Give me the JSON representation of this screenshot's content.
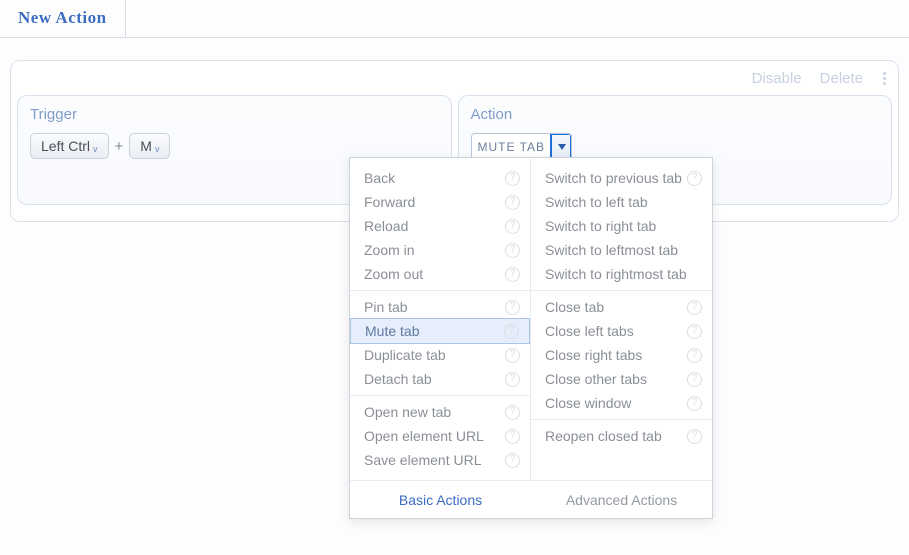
{
  "header": {
    "tab_title": "New Action",
    "disable_label": "Disable",
    "delete_label": "Delete"
  },
  "trigger": {
    "title": "Trigger",
    "keys": [
      "Left Ctrl",
      "M"
    ],
    "joiner": "+"
  },
  "action": {
    "title": "Action",
    "selected_label": "MUTE TAB"
  },
  "popup": {
    "left_groups": [
      {
        "items": [
          {
            "label": "Back",
            "help": true
          },
          {
            "label": "Forward",
            "help": true
          },
          {
            "label": "Reload",
            "help": true
          },
          {
            "label": "Zoom in",
            "help": true
          },
          {
            "label": "Zoom out",
            "help": true
          }
        ]
      },
      {
        "items": [
          {
            "label": "Pin tab",
            "help": true
          },
          {
            "label": "Mute tab",
            "help": true,
            "selected": true
          },
          {
            "label": "Duplicate tab",
            "help": true
          },
          {
            "label": "Detach tab",
            "help": true
          }
        ]
      },
      {
        "items": [
          {
            "label": "Open new tab",
            "help": true
          },
          {
            "label": "Open element URL",
            "help": true
          },
          {
            "label": "Save element URL",
            "help": true
          }
        ]
      }
    ],
    "right_groups": [
      {
        "items": [
          {
            "label": "Switch to previous tab",
            "help": true
          },
          {
            "label": "Switch to left tab",
            "help": false
          },
          {
            "label": "Switch to right tab",
            "help": false
          },
          {
            "label": "Switch to leftmost tab",
            "help": false
          },
          {
            "label": "Switch to rightmost tab",
            "help": false
          }
        ]
      },
      {
        "items": [
          {
            "label": "Close tab",
            "help": true
          },
          {
            "label": "Close left tabs",
            "help": true
          },
          {
            "label": "Close right tabs",
            "help": true
          },
          {
            "label": "Close other tabs",
            "help": true
          },
          {
            "label": "Close window",
            "help": true
          }
        ]
      },
      {
        "items": [
          {
            "label": "Reopen closed tab",
            "help": true
          }
        ]
      }
    ],
    "tabs": {
      "basic": "Basic Actions",
      "advanced": "Advanced Actions"
    }
  }
}
